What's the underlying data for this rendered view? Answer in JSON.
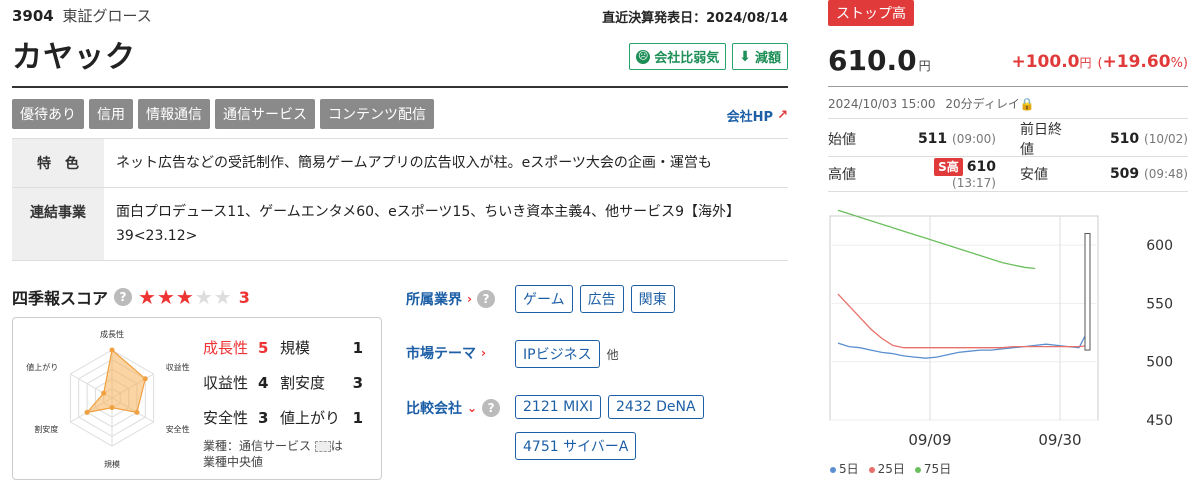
{
  "header": {
    "code": "3904",
    "market": "東証グロース",
    "kessan": "直近決算発表日：2024/08/14",
    "company": "カヤック",
    "badges": [
      {
        "label": "会社比弱気",
        "icon": "frown-face-icon"
      },
      {
        "label": "減額",
        "icon": "arrow-down-icon"
      }
    ]
  },
  "tags": [
    "優待あり",
    "信用",
    "情報通信",
    "通信サービス",
    "コンテンツ配信"
  ],
  "company_hp": "会社HP",
  "info": {
    "feature_label": "特　色",
    "feature": "ネット広告などの受託制作、簡易ゲームアプリの広告収入が柱。eスポーツ大会の企画・運営も",
    "segments_label": "連結事業",
    "segments": "面白プロデュース11、ゲームエンタメ60、eスポーツ15、ちいき資本主義4、他サービス9【海外】39<23.12>"
  },
  "score": {
    "title": "四季報スコア",
    "stars": 3,
    "value": "3",
    "radar_labels": [
      "成長性",
      "収益性",
      "安全性",
      "規模",
      "割安度",
      "値上がり"
    ],
    "radar_values": [
      5,
      4,
      3,
      1,
      3,
      1
    ],
    "items": [
      {
        "label": "成長性",
        "value": "5",
        "highlight": true
      },
      {
        "label": "規模",
        "value": "1"
      },
      {
        "label": "収益性",
        "value": "4"
      },
      {
        "label": "割安度",
        "value": "3"
      },
      {
        "label": "安全性",
        "value": "3"
      },
      {
        "label": "値上がり",
        "value": "1"
      }
    ],
    "note_a": "業種：通信サービス",
    "note_b": "は",
    "note_c": "業種中央値"
  },
  "categories": {
    "industry_label": "所属業界",
    "industry": [
      "ゲーム",
      "広告",
      "関東"
    ],
    "theme_label": "市場テーマ",
    "theme": [
      "IPビジネス"
    ],
    "theme_other": "他",
    "compare_label": "比較会社",
    "compare": [
      "2121 MIXI",
      "2432 DeNA",
      "4751 サイバーA"
    ]
  },
  "quote": {
    "stop_badge": "ストップ高",
    "price": "610.0",
    "yen": "円",
    "change": "+100.0",
    "change_pct": "+19.60",
    "pct_unit": "%",
    "timestamp": "2024/10/03 15:00",
    "delay": "20分ディレイ",
    "open_label": "始値",
    "open": "511",
    "open_time": "(09:00)",
    "prev_label": "前日終値",
    "prev": "510",
    "prev_time": "(10/02)",
    "high_label": "高値",
    "high_badge": "S高",
    "high": "610",
    "high_time": "(13:17)",
    "low_label": "安値",
    "low": "509",
    "low_time": "(09:48)"
  },
  "chart_data": {
    "type": "line",
    "x_labels": [
      "09/09",
      "09/30"
    ],
    "y_ticks": [
      450,
      500,
      550,
      600
    ],
    "ylim": [
      450,
      625
    ],
    "series": [
      {
        "name": "5日",
        "color": "#5b8fcf",
        "values": [
          516,
          513,
          512,
          510,
          508,
          507,
          505,
          504,
          503,
          504,
          506,
          508,
          509,
          510,
          510,
          511,
          512,
          513,
          514,
          515,
          514,
          513,
          512,
          530
        ]
      },
      {
        "name": "25日",
        "color": "#e8706a",
        "values": [
          558,
          548,
          538,
          528,
          520,
          514,
          512,
          512,
          512,
          512,
          512,
          512,
          512,
          512,
          512,
          512,
          513,
          513,
          513,
          513,
          513,
          513,
          513,
          514
        ]
      },
      {
        "name": "75日",
        "color": "#6cbf5e",
        "values": [
          630,
          627,
          624,
          621,
          618,
          615,
          612,
          609,
          606,
          603,
          600,
          597,
          594,
          591,
          588,
          585,
          583,
          581,
          580
        ]
      }
    ],
    "legend": [
      "5日",
      "25日",
      "75日"
    ],
    "grid": true
  },
  "colors": {
    "accent_red": "#e03a3a",
    "link_blue": "#1d5fa6",
    "badge_green": "#1f8f58"
  }
}
